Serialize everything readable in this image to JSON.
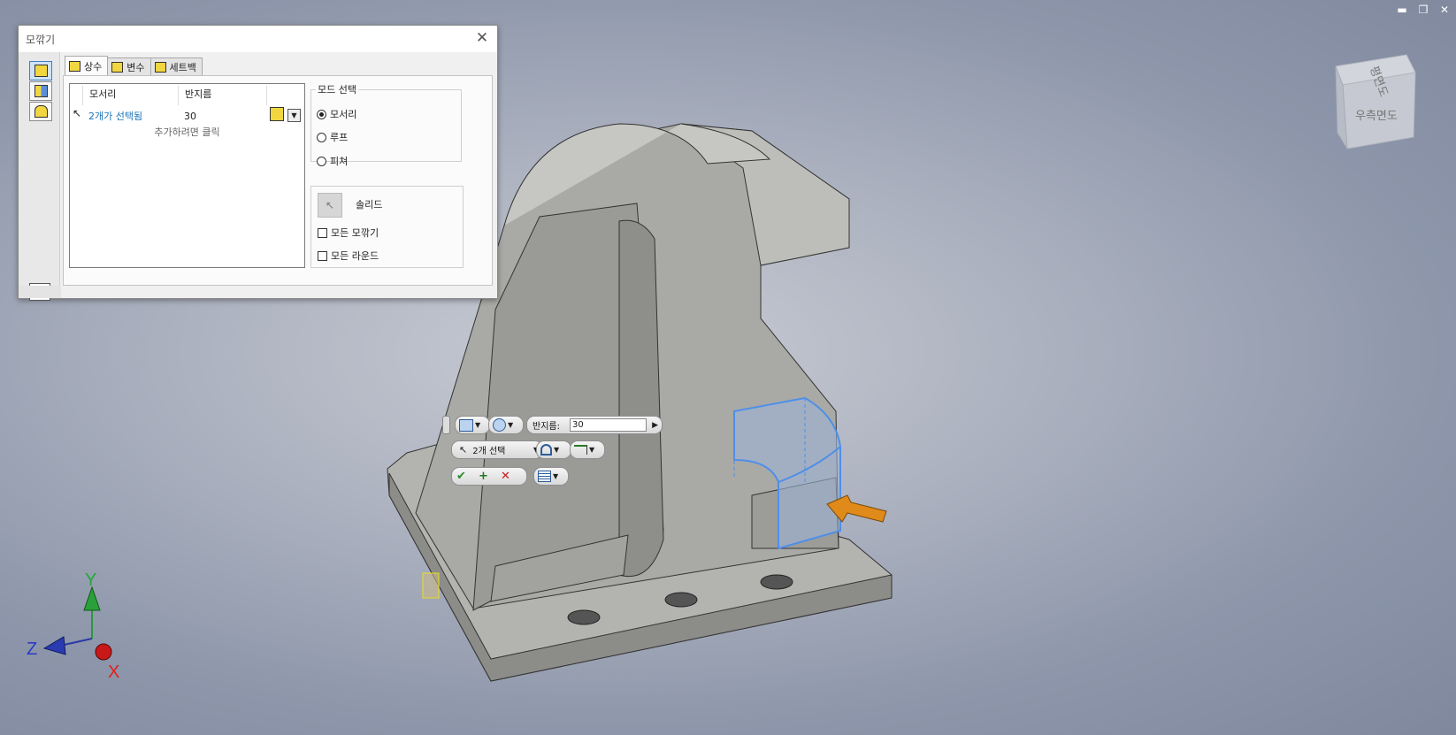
{
  "dialog": {
    "title": "모깎기",
    "tabs": [
      {
        "label": "상수",
        "active": true
      },
      {
        "label": "변수",
        "active": false
      },
      {
        "label": "세트백",
        "active": false
      }
    ],
    "table": {
      "col_edge": "모서리",
      "col_radius": "반지름",
      "row_edge": "2개가 선택됨",
      "row_radius": "30",
      "add_hint": "추가하려면 클릭"
    },
    "mode": {
      "legend": "모드 선택",
      "options": [
        "모서리",
        "루프",
        "피쳐"
      ],
      "selected": "모서리"
    },
    "solid_label": "솔리드",
    "all_fillets_label": "모든 모깎기",
    "all_rounds_label": "모든 라운드",
    "help_label": "?"
  },
  "minitoolbar": {
    "radius_label": "반지름:",
    "radius_value": "30",
    "selection_label": "2개 선택"
  },
  "viewcube": {
    "front_label": "우측면도",
    "top_label": "평면도"
  },
  "triad": {
    "x": "X",
    "y": "Y",
    "z": "Z"
  },
  "window_controls": {
    "minimize": "▬",
    "restore": "❐",
    "close": "✕"
  },
  "colors": {
    "selection_blue": "#4f8fe8",
    "arrow_orange": "#e08a1a",
    "link_blue": "#1a73b6",
    "model_gray": "#a9a9a6"
  }
}
